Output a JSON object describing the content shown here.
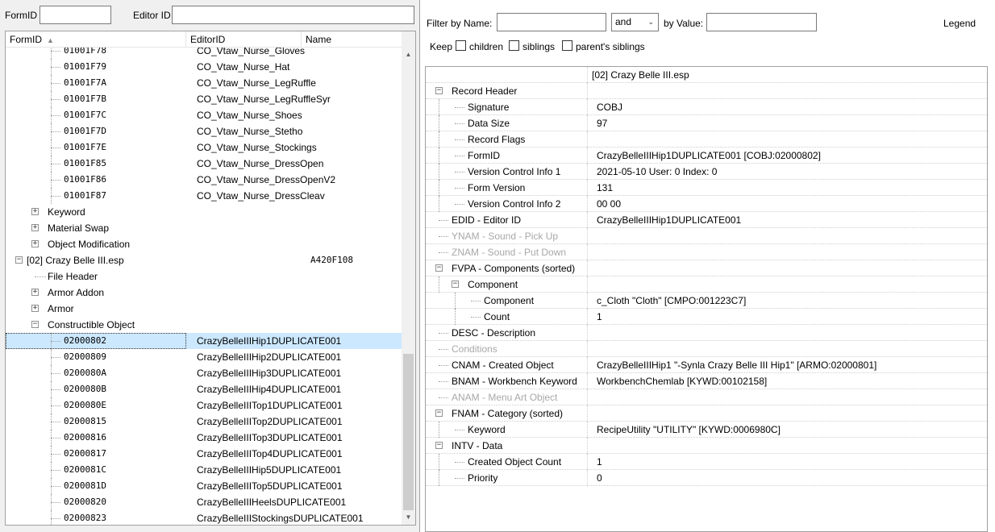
{
  "left_filter": {
    "formid_label": "FormID",
    "editorid_label": "Editor ID",
    "formid_value": "",
    "editorid_value": ""
  },
  "tree": {
    "headers": {
      "formid": "FormID",
      "editorid": "EditorID",
      "name": "Name"
    },
    "rows": [
      {
        "indent": 3,
        "text": "01001F78",
        "editorid": "CO_Vtaw_Nurse_Gloves",
        "name": "",
        "mono": true,
        "exp": null
      },
      {
        "indent": 3,
        "text": "01001F79",
        "editorid": "CO_Vtaw_Nurse_Hat",
        "name": "",
        "mono": true,
        "exp": null
      },
      {
        "indent": 3,
        "text": "01001F7A",
        "editorid": "CO_Vtaw_Nurse_LegRuffle",
        "name": "",
        "mono": true,
        "exp": null
      },
      {
        "indent": 3,
        "text": "01001F7B",
        "editorid": "CO_Vtaw_Nurse_LegRuffleSyr",
        "name": "",
        "mono": true,
        "exp": null
      },
      {
        "indent": 3,
        "text": "01001F7C",
        "editorid": "CO_Vtaw_Nurse_Shoes",
        "name": "",
        "mono": true,
        "exp": null
      },
      {
        "indent": 3,
        "text": "01001F7D",
        "editorid": "CO_Vtaw_Nurse_Stetho",
        "name": "",
        "mono": true,
        "exp": null
      },
      {
        "indent": 3,
        "text": "01001F7E",
        "editorid": "CO_Vtaw_Nurse_Stockings",
        "name": "",
        "mono": true,
        "exp": null
      },
      {
        "indent": 3,
        "text": "01001F85",
        "editorid": "CO_Vtaw_Nurse_DressOpen",
        "name": "",
        "mono": true,
        "exp": null
      },
      {
        "indent": 3,
        "text": "01001F86",
        "editorid": "CO_Vtaw_Nurse_DressOpenV2",
        "name": "",
        "mono": true,
        "exp": null
      },
      {
        "indent": 3,
        "text": "01001F87",
        "editorid": "CO_Vtaw_Nurse_DressCleav",
        "name": "",
        "mono": true,
        "exp": null
      },
      {
        "indent": 2,
        "text": "Keyword",
        "editorid": "",
        "name": "",
        "mono": false,
        "exp": "+"
      },
      {
        "indent": 2,
        "text": "Material Swap",
        "editorid": "",
        "name": "",
        "mono": false,
        "exp": "+"
      },
      {
        "indent": 2,
        "text": "Object Modification",
        "editorid": "",
        "name": "",
        "mono": false,
        "exp": "+"
      },
      {
        "indent": 1,
        "text": "[02] Crazy Belle III.esp",
        "editorid": "",
        "name": "A420F108",
        "mono": false,
        "exp": "-"
      },
      {
        "indent": 2,
        "text": "File Header",
        "editorid": "",
        "name": "",
        "mono": false,
        "exp": null
      },
      {
        "indent": 2,
        "text": "Armor Addon",
        "editorid": "",
        "name": "",
        "mono": false,
        "exp": "+"
      },
      {
        "indent": 2,
        "text": "Armor",
        "editorid": "",
        "name": "",
        "mono": false,
        "exp": "+"
      },
      {
        "indent": 2,
        "text": "Constructible Object",
        "editorid": "",
        "name": "",
        "mono": false,
        "exp": "-"
      },
      {
        "indent": 3,
        "text": "02000802",
        "editorid": "CrazyBelleIIIHip1DUPLICATE001",
        "name": "",
        "mono": true,
        "exp": null,
        "selected": true
      },
      {
        "indent": 3,
        "text": "02000809",
        "editorid": "CrazyBelleIIIHip2DUPLICATE001",
        "name": "",
        "mono": true,
        "exp": null
      },
      {
        "indent": 3,
        "text": "0200080A",
        "editorid": "CrazyBelleIIIHip3DUPLICATE001",
        "name": "",
        "mono": true,
        "exp": null
      },
      {
        "indent": 3,
        "text": "0200080B",
        "editorid": "CrazyBelleIIIHip4DUPLICATE001",
        "name": "",
        "mono": true,
        "exp": null
      },
      {
        "indent": 3,
        "text": "0200080E",
        "editorid": "CrazyBelleIIITop1DUPLICATE001",
        "name": "",
        "mono": true,
        "exp": null
      },
      {
        "indent": 3,
        "text": "02000815",
        "editorid": "CrazyBelleIIITop2DUPLICATE001",
        "name": "",
        "mono": true,
        "exp": null
      },
      {
        "indent": 3,
        "text": "02000816",
        "editorid": "CrazyBelleIIITop3DUPLICATE001",
        "name": "",
        "mono": true,
        "exp": null
      },
      {
        "indent": 3,
        "text": "02000817",
        "editorid": "CrazyBelleIIITop4DUPLICATE001",
        "name": "",
        "mono": true,
        "exp": null
      },
      {
        "indent": 3,
        "text": "0200081C",
        "editorid": "CrazyBelleIIIHip5DUPLICATE001",
        "name": "",
        "mono": true,
        "exp": null
      },
      {
        "indent": 3,
        "text": "0200081D",
        "editorid": "CrazyBelleIIITop5DUPLICATE001",
        "name": "",
        "mono": true,
        "exp": null
      },
      {
        "indent": 3,
        "text": "02000820",
        "editorid": "CrazyBelleIIIHeelsDUPLICATE001",
        "name": "",
        "mono": true,
        "exp": null
      },
      {
        "indent": 3,
        "text": "02000823",
        "editorid": "CrazyBelleIIIStockingsDUPLICATE001",
        "name": "",
        "mono": true,
        "exp": null
      }
    ]
  },
  "right_filter": {
    "filter_by_name": "Filter by Name:",
    "op_value": "and",
    "by_value": "by Value:",
    "legend": "Legend",
    "keep": "Keep",
    "children": "children",
    "siblings": "siblings",
    "parents_siblings": "parent's siblings"
  },
  "record": {
    "file_header": "[02] Crazy Belle III.esp",
    "rows": [
      {
        "indent": 0,
        "label": "Record Header",
        "value": "",
        "exp": "-",
        "gray": false
      },
      {
        "indent": 1,
        "label": "Signature",
        "value": "COBJ",
        "exp": null,
        "gray": false
      },
      {
        "indent": 1,
        "label": "Data Size",
        "value": "97",
        "exp": null,
        "gray": false
      },
      {
        "indent": 1,
        "label": "Record Flags",
        "value": "",
        "exp": null,
        "gray": false
      },
      {
        "indent": 1,
        "label": "FormID",
        "value": "CrazyBelleIIIHip1DUPLICATE001 [COBJ:02000802]",
        "exp": null,
        "gray": false
      },
      {
        "indent": 1,
        "label": "Version Control Info 1",
        "value": "2021-05-10 User: 0 Index: 0",
        "exp": null,
        "gray": false
      },
      {
        "indent": 1,
        "label": "Form Version",
        "value": "131",
        "exp": null,
        "gray": false
      },
      {
        "indent": 1,
        "label": "Version Control Info 2",
        "value": "00 00",
        "exp": null,
        "gray": false
      },
      {
        "indent": 0,
        "label": "EDID - Editor ID",
        "value": "CrazyBelleIIIHip1DUPLICATE001",
        "exp": null,
        "gray": false
      },
      {
        "indent": 0,
        "label": "YNAM - Sound - Pick Up",
        "value": "",
        "exp": null,
        "gray": true
      },
      {
        "indent": 0,
        "label": "ZNAM - Sound - Put Down",
        "value": "",
        "exp": null,
        "gray": true
      },
      {
        "indent": 0,
        "label": "FVPA - Components (sorted)",
        "value": "",
        "exp": "-",
        "gray": false
      },
      {
        "indent": 1,
        "label": "Component",
        "value": "",
        "exp": "-",
        "gray": false
      },
      {
        "indent": 2,
        "label": "Component",
        "value": "c_Cloth \"Cloth\" [CMPO:001223C7]",
        "exp": null,
        "gray": false
      },
      {
        "indent": 2,
        "label": "Count",
        "value": "1",
        "exp": null,
        "gray": false
      },
      {
        "indent": 0,
        "label": "DESC - Description",
        "value": "",
        "exp": null,
        "gray": false
      },
      {
        "indent": 0,
        "label": "Conditions",
        "value": "",
        "exp": null,
        "gray": true
      },
      {
        "indent": 0,
        "label": "CNAM - Created Object",
        "value": "CrazyBelleIIIHip1 \"-Synla Crazy Belle III Hip1\" [ARMO:02000801]",
        "exp": null,
        "gray": false
      },
      {
        "indent": 0,
        "label": "BNAM - Workbench Keyword",
        "value": "WorkbenchChemlab [KYWD:00102158]",
        "exp": null,
        "gray": false
      },
      {
        "indent": 0,
        "label": "ANAM - Menu Art Object",
        "value": "",
        "exp": null,
        "gray": true
      },
      {
        "indent": 0,
        "label": "FNAM - Category (sorted)",
        "value": "",
        "exp": "-",
        "gray": false
      },
      {
        "indent": 1,
        "label": "Keyword",
        "value": "RecipeUtility \"UTILITY\" [KYWD:0006980C]",
        "exp": null,
        "gray": false
      },
      {
        "indent": 0,
        "label": "INTV - Data",
        "value": "",
        "exp": "-",
        "gray": false
      },
      {
        "indent": 1,
        "label": "Created Object Count",
        "value": "1",
        "exp": null,
        "gray": false
      },
      {
        "indent": 1,
        "label": "Priority",
        "value": "0",
        "exp": null,
        "gray": false
      }
    ]
  }
}
